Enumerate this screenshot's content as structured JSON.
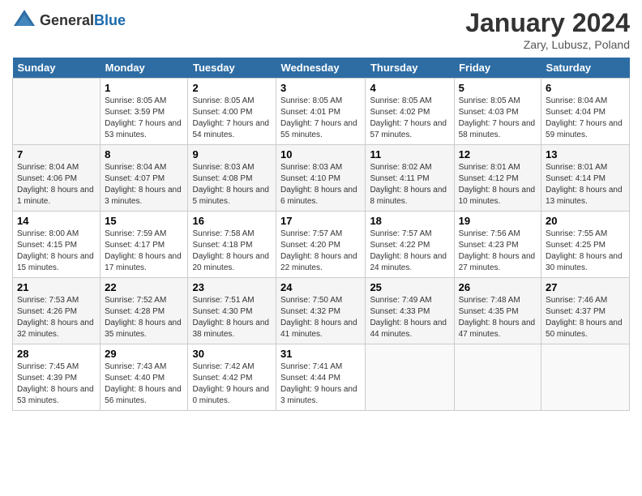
{
  "header": {
    "logo_general": "General",
    "logo_blue": "Blue",
    "title": "January 2024",
    "subtitle": "Zary, Lubusz, Poland"
  },
  "days_of_week": [
    "Sunday",
    "Monday",
    "Tuesday",
    "Wednesday",
    "Thursday",
    "Friday",
    "Saturday"
  ],
  "weeks": [
    [
      {
        "day": "",
        "sunrise": "",
        "sunset": "",
        "daylight": ""
      },
      {
        "day": "1",
        "sunrise": "Sunrise: 8:05 AM",
        "sunset": "Sunset: 3:59 PM",
        "daylight": "Daylight: 7 hours and 53 minutes."
      },
      {
        "day": "2",
        "sunrise": "Sunrise: 8:05 AM",
        "sunset": "Sunset: 4:00 PM",
        "daylight": "Daylight: 7 hours and 54 minutes."
      },
      {
        "day": "3",
        "sunrise": "Sunrise: 8:05 AM",
        "sunset": "Sunset: 4:01 PM",
        "daylight": "Daylight: 7 hours and 55 minutes."
      },
      {
        "day": "4",
        "sunrise": "Sunrise: 8:05 AM",
        "sunset": "Sunset: 4:02 PM",
        "daylight": "Daylight: 7 hours and 57 minutes."
      },
      {
        "day": "5",
        "sunrise": "Sunrise: 8:05 AM",
        "sunset": "Sunset: 4:03 PM",
        "daylight": "Daylight: 7 hours and 58 minutes."
      },
      {
        "day": "6",
        "sunrise": "Sunrise: 8:04 AM",
        "sunset": "Sunset: 4:04 PM",
        "daylight": "Daylight: 7 hours and 59 minutes."
      }
    ],
    [
      {
        "day": "7",
        "sunrise": "Sunrise: 8:04 AM",
        "sunset": "Sunset: 4:06 PM",
        "daylight": "Daylight: 8 hours and 1 minute."
      },
      {
        "day": "8",
        "sunrise": "Sunrise: 8:04 AM",
        "sunset": "Sunset: 4:07 PM",
        "daylight": "Daylight: 8 hours and 3 minutes."
      },
      {
        "day": "9",
        "sunrise": "Sunrise: 8:03 AM",
        "sunset": "Sunset: 4:08 PM",
        "daylight": "Daylight: 8 hours and 5 minutes."
      },
      {
        "day": "10",
        "sunrise": "Sunrise: 8:03 AM",
        "sunset": "Sunset: 4:10 PM",
        "daylight": "Daylight: 8 hours and 6 minutes."
      },
      {
        "day": "11",
        "sunrise": "Sunrise: 8:02 AM",
        "sunset": "Sunset: 4:11 PM",
        "daylight": "Daylight: 8 hours and 8 minutes."
      },
      {
        "day": "12",
        "sunrise": "Sunrise: 8:01 AM",
        "sunset": "Sunset: 4:12 PM",
        "daylight": "Daylight: 8 hours and 10 minutes."
      },
      {
        "day": "13",
        "sunrise": "Sunrise: 8:01 AM",
        "sunset": "Sunset: 4:14 PM",
        "daylight": "Daylight: 8 hours and 13 minutes."
      }
    ],
    [
      {
        "day": "14",
        "sunrise": "Sunrise: 8:00 AM",
        "sunset": "Sunset: 4:15 PM",
        "daylight": "Daylight: 8 hours and 15 minutes."
      },
      {
        "day": "15",
        "sunrise": "Sunrise: 7:59 AM",
        "sunset": "Sunset: 4:17 PM",
        "daylight": "Daylight: 8 hours and 17 minutes."
      },
      {
        "day": "16",
        "sunrise": "Sunrise: 7:58 AM",
        "sunset": "Sunset: 4:18 PM",
        "daylight": "Daylight: 8 hours and 20 minutes."
      },
      {
        "day": "17",
        "sunrise": "Sunrise: 7:57 AM",
        "sunset": "Sunset: 4:20 PM",
        "daylight": "Daylight: 8 hours and 22 minutes."
      },
      {
        "day": "18",
        "sunrise": "Sunrise: 7:57 AM",
        "sunset": "Sunset: 4:22 PM",
        "daylight": "Daylight: 8 hours and 24 minutes."
      },
      {
        "day": "19",
        "sunrise": "Sunrise: 7:56 AM",
        "sunset": "Sunset: 4:23 PM",
        "daylight": "Daylight: 8 hours and 27 minutes."
      },
      {
        "day": "20",
        "sunrise": "Sunrise: 7:55 AM",
        "sunset": "Sunset: 4:25 PM",
        "daylight": "Daylight: 8 hours and 30 minutes."
      }
    ],
    [
      {
        "day": "21",
        "sunrise": "Sunrise: 7:53 AM",
        "sunset": "Sunset: 4:26 PM",
        "daylight": "Daylight: 8 hours and 32 minutes."
      },
      {
        "day": "22",
        "sunrise": "Sunrise: 7:52 AM",
        "sunset": "Sunset: 4:28 PM",
        "daylight": "Daylight: 8 hours and 35 minutes."
      },
      {
        "day": "23",
        "sunrise": "Sunrise: 7:51 AM",
        "sunset": "Sunset: 4:30 PM",
        "daylight": "Daylight: 8 hours and 38 minutes."
      },
      {
        "day": "24",
        "sunrise": "Sunrise: 7:50 AM",
        "sunset": "Sunset: 4:32 PM",
        "daylight": "Daylight: 8 hours and 41 minutes."
      },
      {
        "day": "25",
        "sunrise": "Sunrise: 7:49 AM",
        "sunset": "Sunset: 4:33 PM",
        "daylight": "Daylight: 8 hours and 44 minutes."
      },
      {
        "day": "26",
        "sunrise": "Sunrise: 7:48 AM",
        "sunset": "Sunset: 4:35 PM",
        "daylight": "Daylight: 8 hours and 47 minutes."
      },
      {
        "day": "27",
        "sunrise": "Sunrise: 7:46 AM",
        "sunset": "Sunset: 4:37 PM",
        "daylight": "Daylight: 8 hours and 50 minutes."
      }
    ],
    [
      {
        "day": "28",
        "sunrise": "Sunrise: 7:45 AM",
        "sunset": "Sunset: 4:39 PM",
        "daylight": "Daylight: 8 hours and 53 minutes."
      },
      {
        "day": "29",
        "sunrise": "Sunrise: 7:43 AM",
        "sunset": "Sunset: 4:40 PM",
        "daylight": "Daylight: 8 hours and 56 minutes."
      },
      {
        "day": "30",
        "sunrise": "Sunrise: 7:42 AM",
        "sunset": "Sunset: 4:42 PM",
        "daylight": "Daylight: 9 hours and 0 minutes."
      },
      {
        "day": "31",
        "sunrise": "Sunrise: 7:41 AM",
        "sunset": "Sunset: 4:44 PM",
        "daylight": "Daylight: 9 hours and 3 minutes."
      },
      {
        "day": "",
        "sunrise": "",
        "sunset": "",
        "daylight": ""
      },
      {
        "day": "",
        "sunrise": "",
        "sunset": "",
        "daylight": ""
      },
      {
        "day": "",
        "sunrise": "",
        "sunset": "",
        "daylight": ""
      }
    ]
  ]
}
